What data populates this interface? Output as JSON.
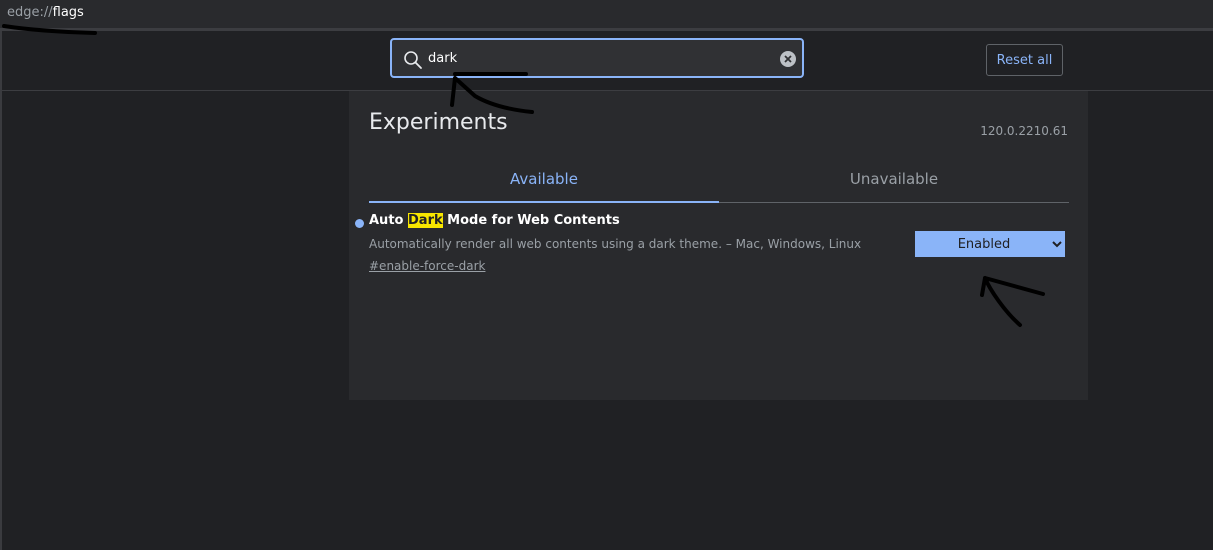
{
  "address_bar": {
    "scheme": "edge://",
    "host": "flags"
  },
  "search": {
    "value": "dark",
    "icon": "search-icon",
    "clear_icon": "clear-icon"
  },
  "header": {
    "reset_label": "Reset all"
  },
  "experiments": {
    "title": "Experiments",
    "version": "120.0.2210.61",
    "tabs": [
      {
        "label": "Available",
        "active": true
      },
      {
        "label": "Unavailable",
        "active": false
      }
    ],
    "flags": [
      {
        "name_before": "Auto ",
        "name_highlight": "Dark",
        "name_after": " Mode for Web Contents",
        "description": "Automatically render all web contents using a dark theme. – Mac, Windows, Linux",
        "link": "#enable-force-dark",
        "selected": "Enabled"
      }
    ]
  },
  "colors": {
    "accent": "#8ab4f8",
    "highlight": "#f7e600",
    "background": "#202124",
    "panel": "#292a2d"
  }
}
